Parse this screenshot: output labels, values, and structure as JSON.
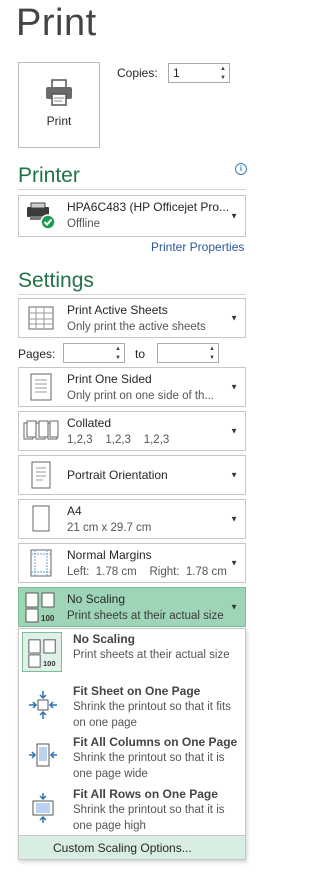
{
  "page": {
    "title": "Print"
  },
  "print_button": {
    "label": "Print",
    "icon": "printer-icon"
  },
  "copies": {
    "label": "Copies:",
    "value": "1"
  },
  "printer": {
    "heading": "Printer",
    "name": "HPA6C483 (HP Officejet Pro...",
    "status": "Offline",
    "properties_link": "Printer Properties"
  },
  "settings": {
    "heading": "Settings",
    "what": {
      "title": "Print Active Sheets",
      "sub": "Only print the active sheets"
    },
    "pages": {
      "label": "Pages:",
      "to_label": "to",
      "from_value": "",
      "to_value": ""
    },
    "sides": {
      "title": "Print One Sided",
      "sub": "Only print on one side of th..."
    },
    "collate": {
      "title": "Collated",
      "sub": "1,2,3    1,2,3    1,2,3"
    },
    "orientation": {
      "title": "Portrait Orientation"
    },
    "paper": {
      "title": "A4",
      "sub": "21 cm x 29.7 cm"
    },
    "margins": {
      "title": "Normal Margins",
      "sub": "Left:  1.78 cm    Right:  1.78 cm"
    },
    "scaling": {
      "title": "No Scaling",
      "sub": "Print sheets at their actual size"
    }
  },
  "scaling_menu": {
    "items": [
      {
        "title": "No Scaling",
        "desc": "Print sheets at their actual size",
        "selected": true
      },
      {
        "title": "Fit Sheet on One Page",
        "desc": "Shrink the printout so that it fits on one page"
      },
      {
        "title": "Fit All Columns on One Page",
        "desc": "Shrink the printout so that it is one page wide"
      },
      {
        "title": "Fit All Rows on One Page",
        "desc": "Shrink the printout so that it is one page high"
      }
    ],
    "custom": "Custom Scaling Options..."
  },
  "colors": {
    "accent": "#217346",
    "selected_bg": "#9fd5b7",
    "link": "#2b579a"
  }
}
